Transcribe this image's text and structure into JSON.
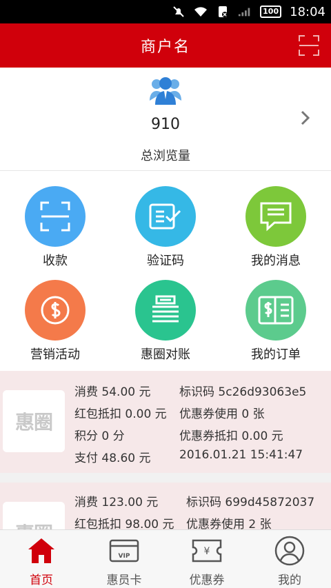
{
  "status_bar": {
    "time": "18:04",
    "battery": "100"
  },
  "header": {
    "title": "商户名"
  },
  "stats": {
    "count": "910",
    "label": "总浏览量"
  },
  "grid": [
    {
      "label": "收款",
      "color": "#4aaaf3",
      "icon": "scan-icon"
    },
    {
      "label": "验证码",
      "color": "#35b8e6",
      "icon": "verify-icon"
    },
    {
      "label": "我的消息",
      "color": "#7dc83a",
      "icon": "message-icon"
    },
    {
      "label": "营销活动",
      "color": "#f47a4a",
      "icon": "coin-icon"
    },
    {
      "label": "惠圈对账",
      "color": "#2ac48f",
      "icon": "ledger-icon"
    },
    {
      "label": "我的订单",
      "color": "#5ccb8d",
      "icon": "order-icon"
    }
  ],
  "records": [
    {
      "logo": "惠圈",
      "consume": "消费 54.00 元",
      "code": "标识码 5c26d93063e5",
      "redpacket": "红包抵扣 0.00 元",
      "coupon_used": "优惠券使用 0 张",
      "points": "积分 0 分",
      "coupon_deduct": "优惠券抵扣 0.00 元",
      "paid": "支付 48.60 元",
      "time": "2016.01.21 15:41:47"
    },
    {
      "logo": "惠圈",
      "consume": "消费 123.00 元",
      "code": "标识码 699d45872037",
      "redpacket": "红包抵扣 98.00 元",
      "coupon_used": "优惠券使用 2 张"
    }
  ],
  "tabs": [
    {
      "label": "首页",
      "icon": "home-icon"
    },
    {
      "label": "惠员卡",
      "icon": "vip-card-icon",
      "badge": "VIP"
    },
    {
      "label": "优惠券",
      "icon": "coupon-icon",
      "badge": "¥"
    },
    {
      "label": "我的",
      "icon": "profile-icon"
    }
  ],
  "colors": {
    "brand": "#d0000b",
    "card_bg": "#f6e8e9"
  }
}
